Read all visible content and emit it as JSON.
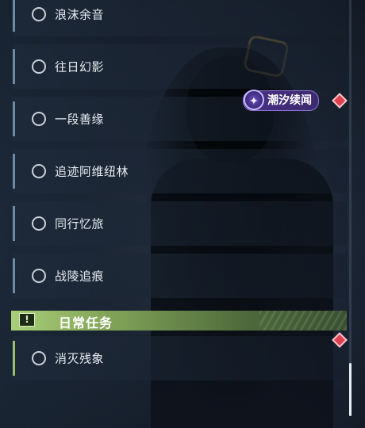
{
  "quests": [
    {
      "label": "浪沫余音"
    },
    {
      "label": "往日幻影"
    },
    {
      "label": "一段善缘"
    },
    {
      "label": "追迹阿维纽林"
    },
    {
      "label": "同行忆旅"
    },
    {
      "label": "战陵追痕"
    }
  ],
  "tag": {
    "label": "潮汐续闻",
    "icon": "tide-sparkle-icon",
    "color": "#4a2f86"
  },
  "daily": {
    "section_title": "日常任务",
    "section_icon": "alert-icon",
    "section_color": "#a9cf78",
    "quests": [
      {
        "label": "消灭残象"
      }
    ]
  },
  "colors": {
    "new_marker": "#e0414f",
    "row_accent": "#6f8aa5"
  }
}
